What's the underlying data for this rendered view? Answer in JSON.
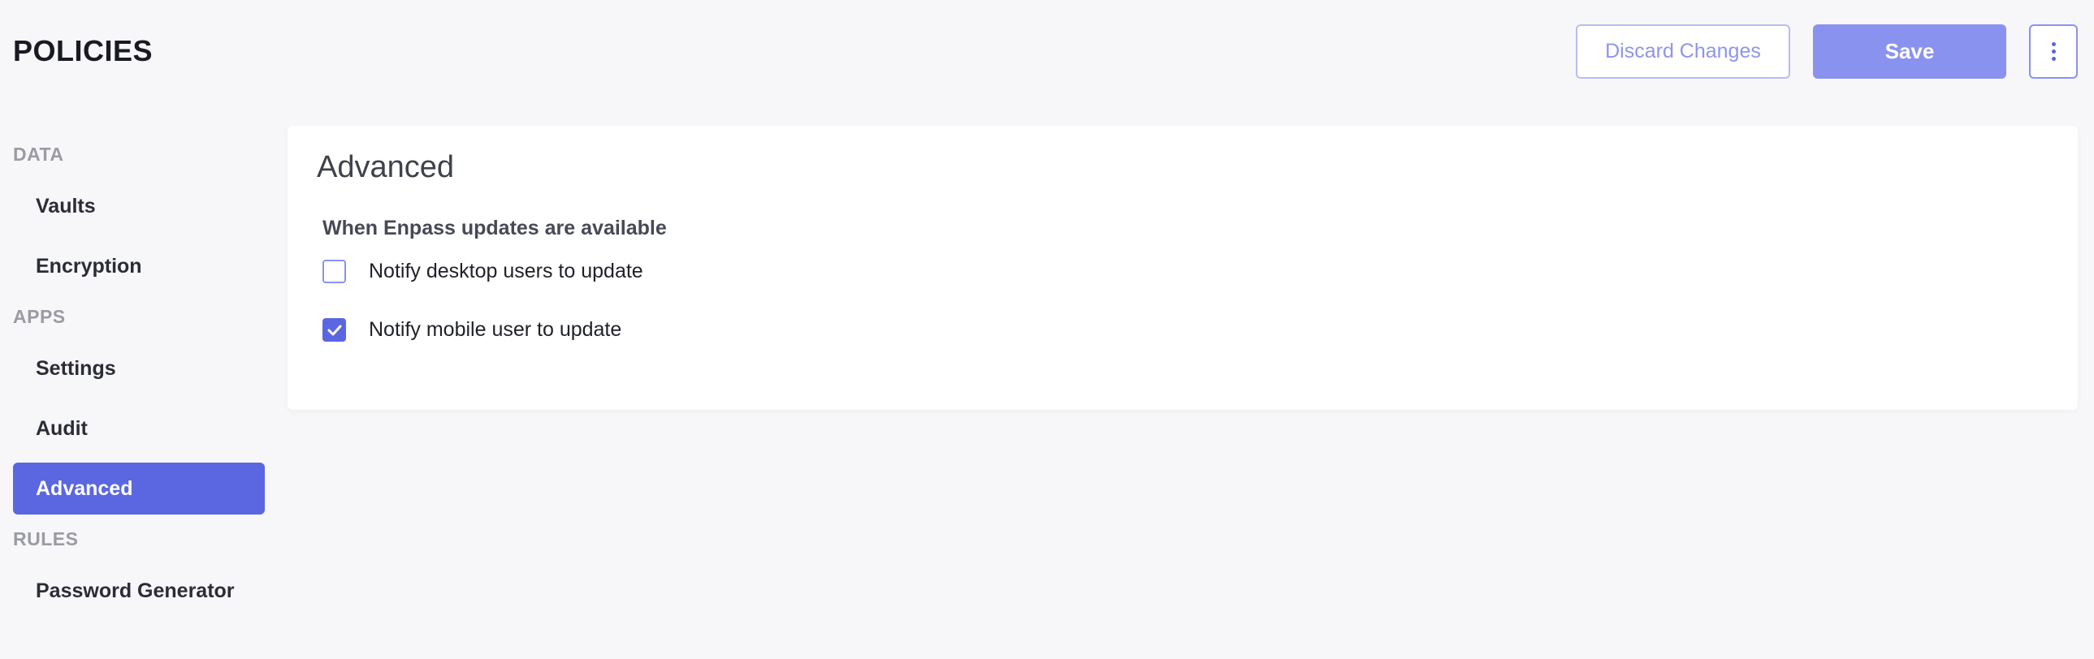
{
  "header": {
    "title": "POLICIES",
    "discard_label": "Discard Changes",
    "save_label": "Save"
  },
  "sidebar": {
    "sections": [
      {
        "label": "DATA",
        "items": [
          {
            "label": "Vaults"
          },
          {
            "label": "Encryption"
          }
        ]
      },
      {
        "label": "APPS",
        "items": [
          {
            "label": "Settings"
          },
          {
            "label": "Audit"
          },
          {
            "label": "Advanced",
            "active": true
          }
        ]
      },
      {
        "label": "RULES",
        "items": [
          {
            "label": "Password Generator"
          }
        ]
      }
    ]
  },
  "main": {
    "title": "Advanced",
    "group_label": "When Enpass updates are available",
    "options": [
      {
        "label": "Notify desktop users to update",
        "checked": false
      },
      {
        "label": "Notify mobile user to update",
        "checked": true
      }
    ]
  },
  "colors": {
    "accent": "#5a67e0",
    "accent_light": "#8a92f0",
    "background": "#f7f7f9"
  }
}
